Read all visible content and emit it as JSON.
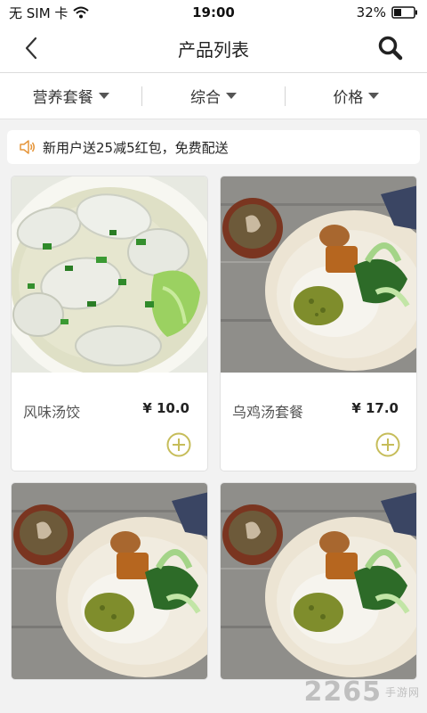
{
  "status_bar": {
    "carrier": "无 SIM 卡",
    "time": "19:00",
    "battery": "32%"
  },
  "nav": {
    "title": "产品列表"
  },
  "filters": [
    {
      "label": "营养套餐"
    },
    {
      "label": "综合"
    },
    {
      "label": "价格"
    }
  ],
  "promo": {
    "text": "新用户送25减5红包，免费配送",
    "icon": "speaker-icon"
  },
  "products": [
    {
      "name": "风味汤饺",
      "price": "¥ 10.0",
      "image": "dumpling-soup"
    },
    {
      "name": "乌鸡汤套餐",
      "price": "¥ 17.0",
      "image": "chicken-soup-set"
    },
    {
      "name": "",
      "price": "",
      "image": "chicken-soup-set"
    },
    {
      "name": "",
      "price": "",
      "image": "chicken-soup-set"
    }
  ],
  "watermark": {
    "text": "2265",
    "subtext": "手游网"
  },
  "colors": {
    "accent": "#c6bd5a",
    "background": "#f2f2f2",
    "promo_icon": "#e5953a"
  }
}
